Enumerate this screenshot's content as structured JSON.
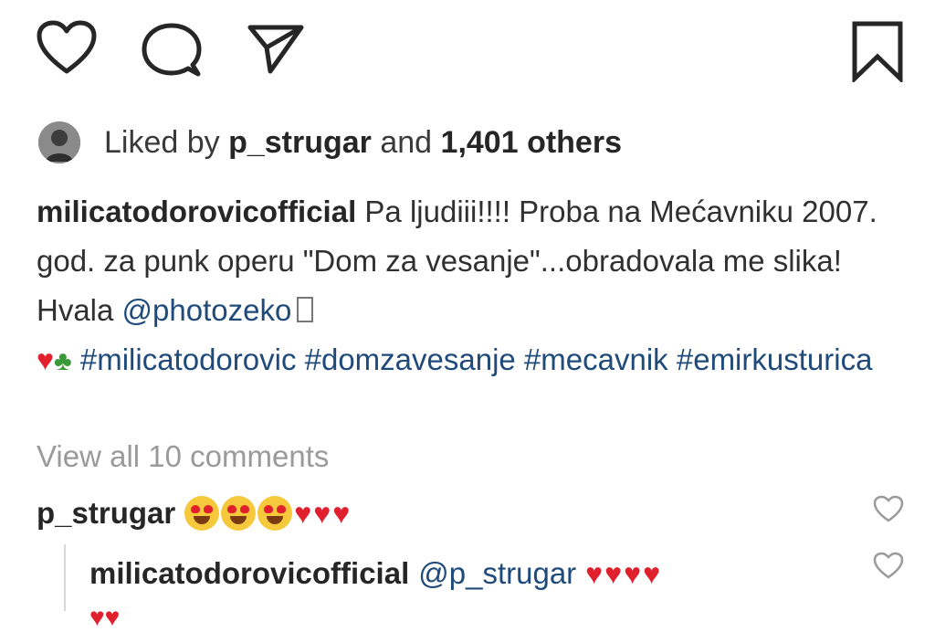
{
  "actions": {
    "like_icon": "heart-outline-icon",
    "comment_icon": "comment-bubble-icon",
    "share_icon": "paper-plane-icon",
    "save_icon": "bookmark-icon"
  },
  "likes": {
    "prefix": "Liked by ",
    "user": "p_strugar",
    "middle": " and ",
    "count": "1,401 others"
  },
  "caption": {
    "user": "milicatodorovicofficial",
    "text_1": " Pa ljudiii!!!! Proba na Mećavniku 2007. god. za punk operu \"Dom za vesanje\"...obradovala me slika! Hvala ",
    "mention": "@photozeko",
    "hashtags": [
      "#milicatodorovic",
      "#domzavesanje",
      "#mecavnik",
      "#emirkusturica"
    ]
  },
  "view_all": "View all 10 comments",
  "comments": [
    {
      "user": "p_strugar",
      "emoji": "heart-eyes x3, red hearts x3"
    },
    {
      "user": "milicatodorovicofficial",
      "mention": "@p_strugar",
      "emoji": "red hearts x4"
    }
  ],
  "colors": {
    "text": "#262626",
    "hashtag": "#1f4a7a",
    "muted": "#9a9a9a",
    "heart": "#e0202c"
  }
}
